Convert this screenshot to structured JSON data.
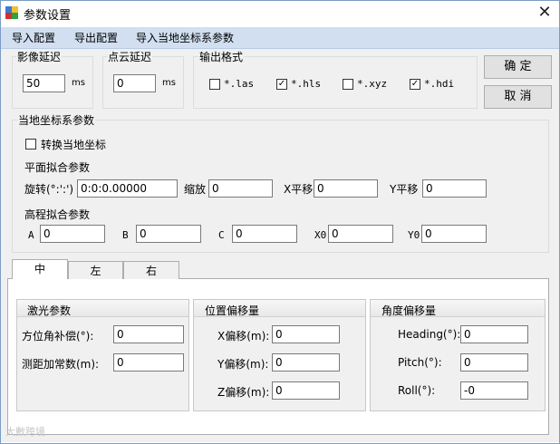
{
  "window": {
    "title": "参数设置",
    "close_glyph": "✕",
    "icon": "app-settings-icon"
  },
  "menu": {
    "items": [
      "导入配置",
      "导出配置",
      "导入当地坐标系参数"
    ]
  },
  "image_delay": {
    "legend": "影像延迟",
    "value": "50",
    "unit": "ms"
  },
  "point_delay": {
    "legend": "点云延迟",
    "value": "0",
    "unit": "ms"
  },
  "output": {
    "legend": "输出格式",
    "formats": [
      {
        "label": "*.las",
        "checked": false
      },
      {
        "label": "*.hls",
        "checked": true
      },
      {
        "label": "*.xyz",
        "checked": false
      },
      {
        "label": "*.hdi",
        "checked": true
      }
    ]
  },
  "buttons": {
    "ok": "确  定",
    "cancel": "取  消"
  },
  "local_coords": {
    "legend": "当地坐标系参数",
    "convert_label": "转换当地坐标",
    "convert_checked": false,
    "plane_title": "平面拟合参数",
    "rotate_label": "旋转(°:':')",
    "rotate_value": "0:0:0.00000",
    "scale_label": "缩放",
    "scale_value": "0",
    "xshift_label": "X平移",
    "xshift_value": "0",
    "yshift_label": "Y平移",
    "yshift_value": "0",
    "elev_title": "高程拟合参数",
    "a_label": "A",
    "a_value": "0",
    "b_label": "B",
    "b_value": "0",
    "c_label": "C",
    "c_value": "0",
    "x0_label": "X0",
    "x0_value": "0",
    "y0_label": "Y0",
    "y0_value": "0"
  },
  "tabs": {
    "items": [
      "中",
      "左",
      "右"
    ],
    "active": 0
  },
  "laser": {
    "title": "激光参数",
    "azimuth_label": "方位角补偿(°):",
    "azimuth_value": "0",
    "range_label": "测距加常数(m):",
    "range_value": "0"
  },
  "position": {
    "title": "位置偏移量",
    "x_label": "X偏移(m):",
    "x_value": "0",
    "y_label": "Y偏移(m):",
    "y_value": "0",
    "z_label": "Z偏移(m):",
    "z_value": "0"
  },
  "angle": {
    "title": "角度偏移量",
    "heading_label": "Heading(°):",
    "heading_value": "0",
    "pitch_label": "Pitch(°):",
    "pitch_value": "0",
    "roll_label": "Roll(°):",
    "roll_value": "-0"
  },
  "watermark": {
    "text": "大數跨境"
  }
}
